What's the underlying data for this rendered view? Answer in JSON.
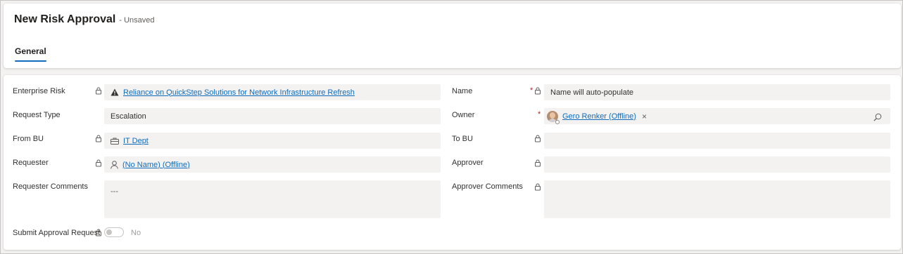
{
  "header": {
    "title": "New Risk Approval",
    "title_suffix": "- Unsaved",
    "tab_general": "General"
  },
  "form": {
    "enterprise_risk": {
      "label": "Enterprise Risk",
      "value": "Reliance on QuickStep Solutions for Network Infrastructure Refresh",
      "icon": "warning-icon"
    },
    "request_type": {
      "label": "Request Type",
      "value": "Escalation"
    },
    "from_bu": {
      "label": "From BU",
      "value": "IT Dept",
      "icon": "business-unit-icon"
    },
    "requester": {
      "label": "Requester",
      "value": "(No Name) (Offline)",
      "icon": "person-icon"
    },
    "requester_comments": {
      "label": "Requester Comments",
      "value": "---"
    },
    "submit_approval": {
      "label": "Submit Approval Request",
      "value": "No"
    },
    "name": {
      "label": "Name",
      "value": "Name will auto-populate",
      "required": "*"
    },
    "owner": {
      "label": "Owner",
      "value": "Gero Renker (Offline)",
      "required": "*",
      "remove": "×"
    },
    "to_bu": {
      "label": "To BU",
      "value": ""
    },
    "approver": {
      "label": "Approver",
      "value": ""
    },
    "approver_comments": {
      "label": "Approver Comments",
      "value": ""
    }
  },
  "colors": {
    "accent": "#0f6cbd",
    "required": "#a4262c",
    "field_bg": "#f3f2f1"
  }
}
